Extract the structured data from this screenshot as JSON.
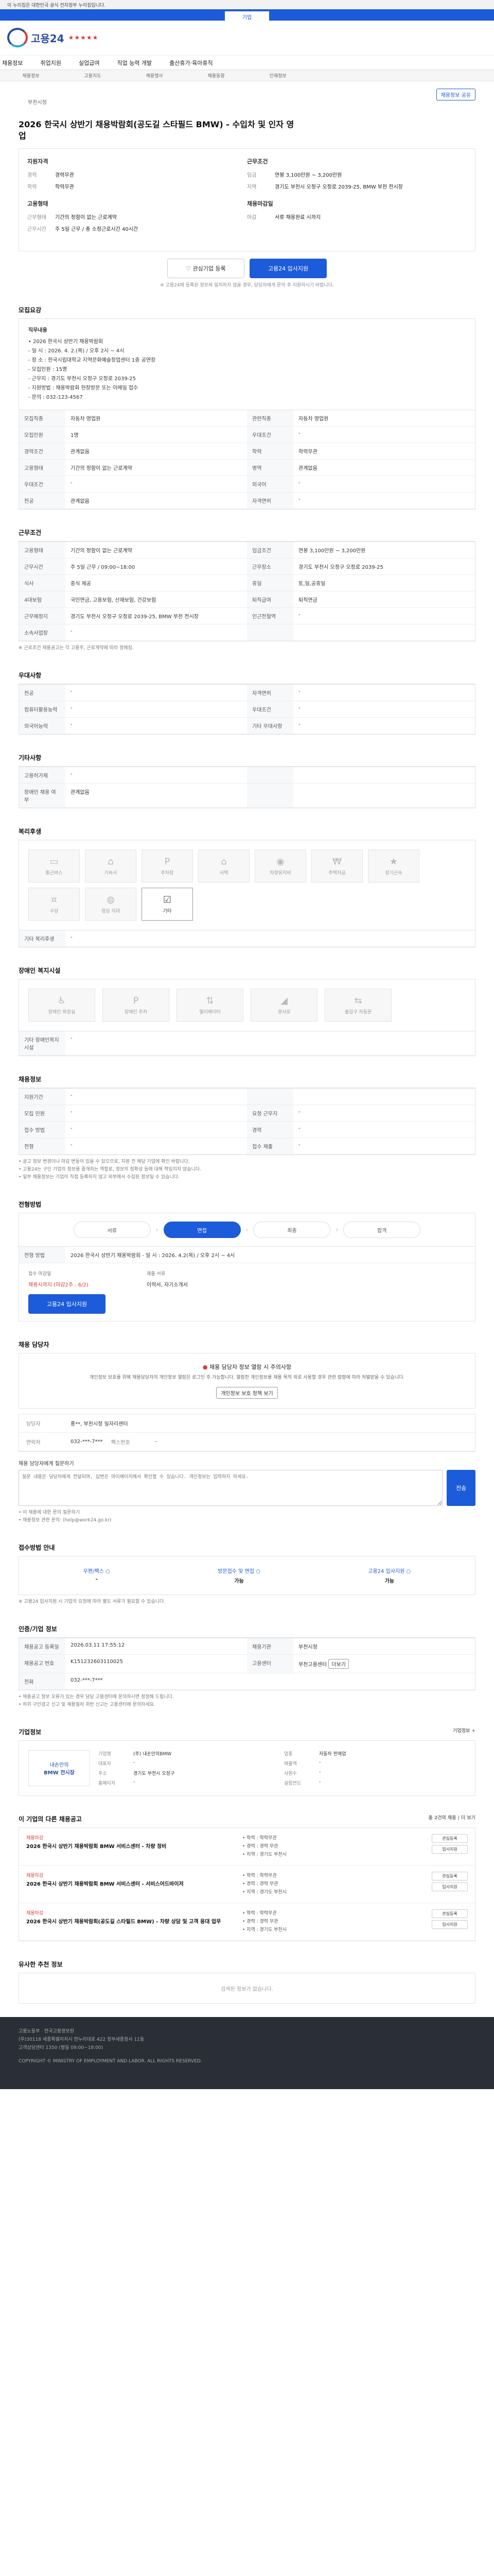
{
  "top": {
    "notice": "이 누리집은 대한민국 공식 전자정부 누리집입니다.",
    "tab": "기업"
  },
  "brand": {
    "logo_text": "고용24",
    "stars": "★★★★★"
  },
  "nav": [
    "채용정보",
    "취업지원",
    "실업급여",
    "직업 능력 개발",
    "출산휴가·육아휴직"
  ],
  "subnav": [
    "채용정보",
    "고용지도",
    "채용행사",
    "채용동향",
    "인재정보"
  ],
  "job": {
    "company": "부천시청",
    "title": "2026 한국시 상반기 채용박람회(공도길 스타필드 BMW) - 수입차 및 인자 영업",
    "bookmark_btn": "채용정보 공유"
  },
  "summary": {
    "left_head": "지원자격",
    "left": [
      [
        "경력",
        "경력무관"
      ],
      [
        "학력",
        "학력무관"
      ]
    ],
    "left2_head": "고용형태",
    "left2": [
      [
        "근무형태",
        "기간의 정함이 없는 근로계약"
      ],
      [
        "근무시간",
        "주 5일 근무 / 총 소정근로시간 40시간"
      ]
    ],
    "right_head": "근무조건",
    "right": [
      [
        "임금",
        "연봉 3,100만원 ~ 3,200만원"
      ],
      [
        "지역",
        "경기도 부천시 오정구 오정로 2039-25, BMW 부천 전시장"
      ]
    ],
    "right2_head": "채용마감일",
    "right2": [
      [
        "마감",
        "서류 채용완료 시까지"
      ]
    ]
  },
  "actions": {
    "interest": "관심기업 등록",
    "apply": "고용24 입사지원"
  },
  "note": "※ 고용24에 등록된 정보와 일치하지 않을 경우, 담당자에게 문의 후 지원하시기 바랍니다.",
  "sec_recruit": {
    "title": "모집요강",
    "duty_label": "직무내용",
    "duty": [
      "• 2026 한국시 상반기 채용박람회",
      "- 일 시 : 2026. 4. 2.(목) / 오후 2시 ~ 4시",
      "- 장 소 : 한국시립대학교 지역문화예술창업센터 1층 공연장",
      "- 모집인원 : 15명",
      "- 근무지 : 경기도 부천시 오정구 오정로 2039-25",
      "- 지원방법 : 채용박람회 현장방문 또는 이메일 접수",
      "- 문의 : 032-123-4567"
    ],
    "grid": [
      [
        "모집직종",
        "자동차 영업원",
        "관련직종",
        "자동차 영업원"
      ],
      [
        "모집인원",
        "1명",
        "우대조건",
        "-"
      ],
      [
        "경력조건",
        "관계없음",
        "학력",
        "학력무관"
      ],
      [
        "고용형태",
        "기간의 정함이 없는 근로계약",
        "병역",
        "관계없음"
      ],
      [
        "우대조건",
        "-",
        "외국어",
        "-"
      ],
      [
        "전공",
        "관계없음",
        "자격면허",
        "-"
      ]
    ]
  },
  "sec_cond": {
    "title": "근무조건",
    "grid": [
      [
        "고용형태",
        "기간의 정함이 없는 근로계약",
        "임금조건",
        "연봉 3,100만원 ~ 3,200만원"
      ],
      [
        "근무시간",
        "주 5일 근무 / 09:00~18:00",
        "근무장소",
        "경기도 부천시 오정구 오정로 2039-25"
      ],
      [
        "식사",
        "중식 제공",
        "휴일",
        "토,일,공휴일"
      ],
      [
        "4대보험",
        "국민연금, 고용보험, 산재보험, 건강보험",
        "퇴직급여",
        "퇴직연금"
      ],
      [
        "근무예정지",
        "경기도 부천시 오정구 오정로 2039-25, BMW 부천 전시장",
        "인근전철역",
        "-"
      ],
      [
        "소속사업장",
        "-",
        "",
        ""
      ]
    ],
    "note": "※ 근로조건 채용공고는 각 고용주, 근로계약에 따라 정해짐."
  },
  "sec_pref": {
    "title": "우대사항",
    "grid": [
      [
        "전공",
        "-",
        "자격면허",
        "-"
      ],
      [
        "컴퓨터활용능력",
        "-",
        "우대조건",
        "-"
      ],
      [
        "외국어능력",
        "-",
        "기타 우대사항",
        "-"
      ]
    ]
  },
  "sec_etc": {
    "title": "기타사항",
    "grid": [
      [
        "고용허가제",
        "-",
        "",
        ""
      ],
      [
        "장애인 채용 여부",
        "관계없음",
        "",
        ""
      ]
    ]
  },
  "sec_welfare": {
    "title": "복리후생",
    "tiles": [
      "통근버스",
      "기숙사",
      "주차장",
      "사택",
      "차량유지비",
      "주택자금",
      "장기근속",
      "수당",
      "점심 식대",
      "기타"
    ],
    "active_index": 9,
    "etc_label": "기타 복리후생",
    "etc_value": "-"
  },
  "sec_disabled": {
    "title": "장애인 복지시설",
    "tiles": [
      "장애인 화장실",
      "장애인 주차",
      "엘리베이터",
      "경사로",
      "출입구 자동문"
    ],
    "etc_label": "기타 장애인복지 시설",
    "etc_value": "-"
  },
  "sec_place": {
    "title": "채용정보",
    "grid": [
      [
        "지원기간",
        "-",
        "",
        ""
      ],
      [
        "모집 인원",
        "-",
        "요청 근무지",
        "-"
      ],
      [
        "접수 방법",
        "-",
        "경력",
        "-"
      ],
      [
        "전형",
        "-",
        "접수 제출",
        "-"
      ]
    ],
    "notes": [
      "• 공고 정보 변경이나 마감 변동이 있을 수 있으므로, 지원 전 해당 기업에 확인 바랍니다.",
      "• 고용24는 구인 기업의 정보를 중개하는 역할로, 정보의 정확성 등에 대해 책임지지 않습니다.",
      "• 일부 채용정보는 기업이 직접 등록하지 않고 외부에서 수집된 정보일 수 있습니다."
    ]
  },
  "sec_process": {
    "title": "전형방법",
    "steps": [
      "서류",
      "면접",
      "최종",
      "합격"
    ],
    "active_index": 1,
    "detail_label": "전형 방법",
    "detail": "2026 한국시 상반기 채용박람회 - 일 시 : 2026. 4.2(목) / 오후 2시 ~ 4시",
    "deadline_label": "접수 마감일",
    "deadline": "채용시까지 (마감2주 : 6/2)",
    "apply_btn": "고용24 입사지원",
    "docs_label": "제출 서류",
    "docs": "이력서, 자기소개서"
  },
  "sec_contact": {
    "title": "채용 담당자",
    "warn_title": "채용 담당자 정보 열람 시 주의사항",
    "warn_text": "개인정보 보호를 위해 채용담당자의 개인정보 열람은 로그인 후 가능합니다. 열람한 개인정보를 채용 목적 외로 사용할 경우 관련 법령에 따라 처벌받을 수 있습니다.",
    "login_btn": "개인정보 보호 정책 보기",
    "name_label": "담당자",
    "name": "홍**, 부천시청 일자리센터",
    "tel_label": "연락처",
    "tel": "032-***-7***",
    "fax_label": "팩스번호",
    "fax": "-",
    "q_label": "채용 담당자에게 질문하기",
    "q_placeholder": "질문 내용은 담당자에게 전달되며, 답변은 마이페이지에서 확인할 수 있습니다. 개인정보는 입력하지 마세요.",
    "q_btn": "전송",
    "notes": [
      "• 이 채용에 대한 문의 질문하기",
      "• 채용정보 관련 문의: (help@work24.go.kr)"
    ]
  },
  "sec_method": {
    "title": "접수방법 안내",
    "items": [
      {
        "t": "우편/팩스 ○",
        "v": "-"
      },
      {
        "t": "방문접수 및 면접 ○",
        "v": "가능"
      },
      {
        "t": "고용24 입사지원 ○",
        "v": "가능"
      }
    ],
    "note": "※ 고용24 입사지원 시 기업의 요청에 따라 별도 서류가 필요할 수 있습니다."
  },
  "sec_reg": {
    "title": "인증/기업 정보",
    "row": [
      [
        "채용공고 등록일",
        "2026.03.11 17:55:12"
      ],
      [
        "채용기관",
        "부천시청"
      ],
      [
        "채용공고 번호",
        "K151232603110025"
      ],
      [
        "고용센터",
        "부천고용센터"
      ]
    ],
    "extra_btn": "더보기",
    "tel_label": "전화",
    "tel": "032-***-7***",
    "notes": [
      "• 채용공고 정보 오류가 있는 경우 담당 고용센터에 문의하시면 정정해 드립니다.",
      "• 허위 구인광고 신고 및 채용절차 위반 신고는 고용센터에 문의하세요."
    ]
  },
  "sec_company": {
    "title": "기업정보",
    "toggle": "기업정보 +",
    "logo_line1": "내손안의",
    "logo_line2": "BMW 전시장",
    "grid": [
      [
        "기업명",
        "(주) 내손안의BMW",
        "업종",
        "자동차 판매업"
      ],
      [
        "대표자",
        "-",
        "매출액",
        "-"
      ],
      [
        "주소",
        "경기도 부천시 오정구",
        "사원수",
        "-"
      ],
      [
        "홈페이지",
        "-",
        "설립연도",
        "-"
      ]
    ]
  },
  "sec_similar": {
    "title": "이 기업의 다른 채용공고",
    "more": "총 2건의 채용 | 더 보기",
    "items": [
      {
        "c": "채용마감",
        "t": "2026 한국시 상반기 채용박람회 BMW 서비스센터 - 차량 정비",
        "m": "• 학력 : 학력무관\n• 경력 : 경력 무관\n• 지역 : 경기도 부천시",
        "b1": "관심등록",
        "b2": "입사지원"
      },
      {
        "c": "채용마감",
        "t": "2026 한국시 상반기 채용박람회 BMW 서비스센터 - 서비스어드바이저",
        "m": "• 학력 : 학력무관\n• 경력 : 경력 무관\n• 지역 : 경기도 부천시",
        "b1": "관심등록",
        "b2": "입사지원"
      },
      {
        "c": "채용마감",
        "t": "2026 한국시 상반기 채용박람회(공도길 스타필드 BMW) - 차량 상담 및 고객 응대 업무",
        "m": "• 학력 : 학력무관\n• 경력 : 경력 무관\n• 지역 : 경기도 부천시",
        "b1": "관심등록",
        "b2": "입사지원"
      }
    ]
  },
  "sec_recommend": {
    "title": "유사한 추천 정보",
    "empty": "검색된 정보가 없습니다."
  },
  "footer": {
    "line1": "고용노동부 · 한국고용정보원",
    "line2": "(우)30118 세종특별자치시 한누리대로 422 정부세종청사 11동",
    "line3": "고객상담센터 1350 (평일 09:00~18:00)",
    "copy": "COPYRIGHT © MINISTRY OF EMPLOYMENT AND LABOR. ALL RIGHTS RESERVED."
  }
}
